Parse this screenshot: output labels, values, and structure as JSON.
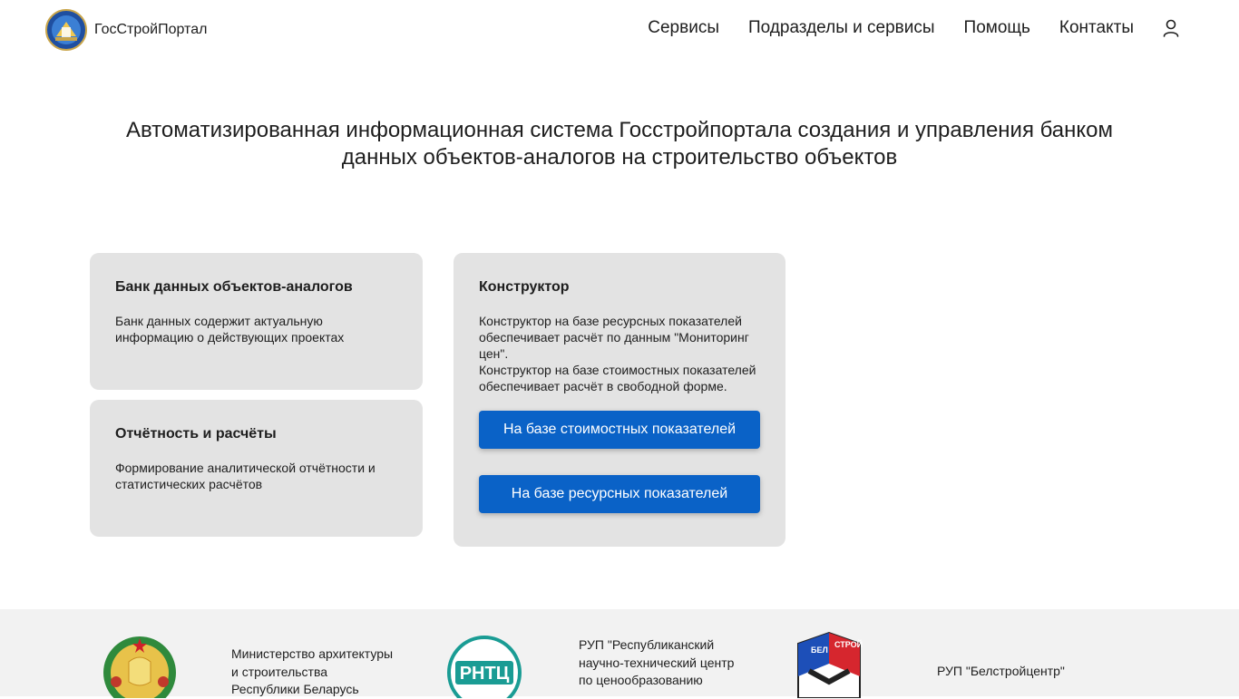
{
  "header": {
    "logo_text": "ГосСтройПортал",
    "nav": [
      "Сервисы",
      "Подразделы и сервисы",
      "Помощь",
      "Контакты"
    ],
    "user_icon": "user-icon"
  },
  "main": {
    "title": "Автоматизированная информационная система Госстройпортала создания и управления банком данных объектов-аналогов на строительство объектов"
  },
  "cards": {
    "bank": {
      "title": "Банк данных объектов-аналогов",
      "text": "Банк данных содержит актуальную информацию о действующих проектах"
    },
    "report": {
      "title": "Отчётность и расчёты",
      "text": "Формирование аналитической отчётности и статистических расчётов"
    },
    "constructor": {
      "title": "Конструктор",
      "text1": "Конструктор на базе ресурсных показателей обеспечивает расчёт по данным \"Мониторинг цен\".",
      "text2": "Конструктор на базе стоимостных показателей обеспечивает расчёт в свободной форме.",
      "btn_cost": "На базе стоимостных показателей",
      "btn_resource": "На базе ресурсных показателей"
    }
  },
  "footer": {
    "ministry_line1": "Министерство архитектуры",
    "ministry_line2": "и строительства",
    "ministry_line3": "Республики Беларусь",
    "rntc_logo_text": "РНТЦ",
    "rntc_line1": "РУП \"Республиканский",
    "rntc_line2": "научно-технический центр",
    "rntc_line3": "по ценообразованию",
    "bsc_logo_left": "БЕЛ",
    "bsc_logo_right": "СТРОЙ",
    "bsc_name": "РУП \"Белстройцентр\""
  },
  "colors": {
    "accent": "#0a62c7",
    "card_bg": "#e3e3e3",
    "footer_bg": "#f2f2f2",
    "text": "#1e1e1e"
  }
}
